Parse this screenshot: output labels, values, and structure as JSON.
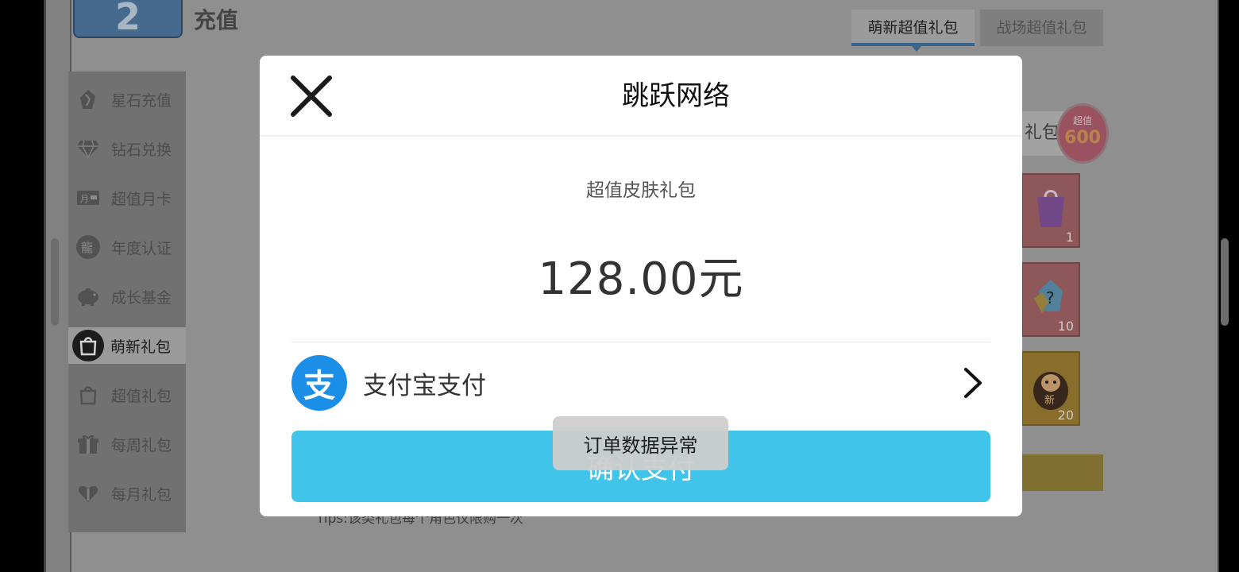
{
  "header": {
    "badge_number": "2",
    "title": "充值"
  },
  "top_tabs": [
    {
      "label": "萌新超值礼包",
      "active": true
    },
    {
      "label": "战场超值礼包",
      "active": false
    }
  ],
  "sidebar": {
    "items": [
      {
        "label": "星石充值",
        "icon": "star-stone-icon",
        "active": false
      },
      {
        "label": "钻石兑换",
        "icon": "diamond-icon",
        "active": false
      },
      {
        "label": "超值月卡",
        "icon": "month-card-icon",
        "active": false
      },
      {
        "label": "年度认证",
        "icon": "dragon-seal-icon",
        "active": false
      },
      {
        "label": "成长基金",
        "icon": "piggy-bank-icon",
        "active": false
      },
      {
        "label": "萌新礼包",
        "icon": "gift-bag-icon",
        "active": true
      },
      {
        "label": "超值礼包",
        "icon": "gift-bag-icon",
        "active": false
      },
      {
        "label": "每周礼包",
        "icon": "gift-box-icon",
        "active": false
      },
      {
        "label": "每月礼包",
        "icon": "heart-gift-icon",
        "active": false
      }
    ]
  },
  "background_panel": {
    "banner_text": "礼包",
    "badge_top": "超值",
    "badge_value": "600",
    "slots": [
      {
        "qty": "1"
      },
      {
        "qty": "10"
      },
      {
        "qty": "20"
      }
    ],
    "tips": "Tips:该类礼包每个角色仅限购一次"
  },
  "dialog": {
    "title": "跳跃网络",
    "product_name": "超值皮肤礼包",
    "price": "128.00元",
    "payment_method": "支付宝支付",
    "alipay_glyph": "支",
    "confirm_label": "确认支付",
    "confirm_color": "#40c4e9"
  },
  "toast": {
    "message": "订单数据异常"
  }
}
